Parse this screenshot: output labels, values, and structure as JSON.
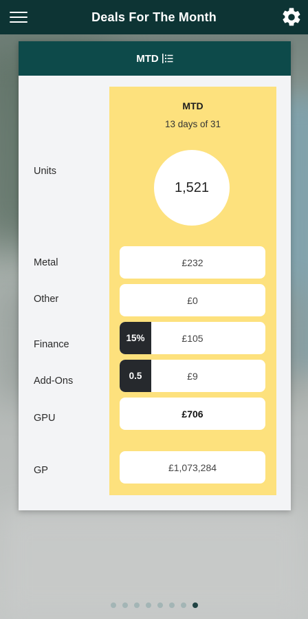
{
  "app_bar": {
    "title": "Deals For The Month",
    "menu_icon": "hamburger-menu-icon",
    "settings_icon": "gear-icon"
  },
  "card": {
    "header_label": "MTD",
    "header_icon": "list-icon",
    "panel_title": "MTD",
    "panel_subtitle": "13 days of 31",
    "rows": {
      "units": {
        "label": "Units",
        "value": "1,521"
      },
      "metal": {
        "label": "Metal",
        "value": "£232"
      },
      "other": {
        "label": "Other",
        "value": "£0"
      },
      "finance": {
        "label": "Finance",
        "badge": "15%",
        "value": "£105"
      },
      "addons": {
        "label": "Add-Ons",
        "badge": "0.5",
        "value": "£9"
      },
      "gpu": {
        "label": "GPU",
        "value": "£706"
      },
      "gp": {
        "label": "GP",
        "value": "£1,073,284"
      }
    }
  },
  "pager": {
    "count": 8,
    "active_index": 7
  },
  "colors": {
    "app_bar": "#0d3434",
    "card_header": "#0d4a4a",
    "panel": "#fde17d",
    "badge": "#26292d"
  }
}
